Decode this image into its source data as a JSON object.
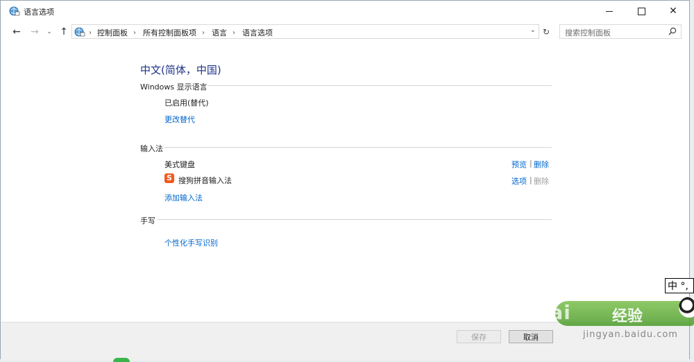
{
  "window": {
    "title": "语言选项",
    "controls": {
      "minimize": "—",
      "maximize": "□",
      "close": "✕"
    }
  },
  "nav": {
    "back": "←",
    "forward": "→",
    "recent": "⌄",
    "up": "↑",
    "breadcrumbs": [
      "控制面板",
      "所有控制面板项",
      "语言",
      "语言选项"
    ],
    "separator": "›",
    "dropdown": "⌄",
    "refresh": "↻",
    "search_placeholder": "搜索控制面板"
  },
  "content": {
    "heading": "中文(简体，中国)",
    "display_language": {
      "label": "Windows 显示语言",
      "status": "已启用(替代)",
      "change_link": "更改替代"
    },
    "input_methods": {
      "label": "输入法",
      "items": [
        {
          "name": "美式键盘",
          "action1": "预览",
          "action2": "删除",
          "action2_enabled": true
        },
        {
          "name": "搜狗拼音输入法",
          "icon": "sogou-icon",
          "action1": "选项",
          "action2": "删除",
          "action2_enabled": false
        }
      ],
      "pipe": "|",
      "add_link": "添加输入法"
    },
    "handwriting": {
      "label": "手写",
      "personalize_link": "个性化手写识别"
    }
  },
  "footer": {
    "save": "保存",
    "cancel": "取消"
  },
  "overlay": {
    "ime_indicator": "中 °,",
    "watermark_brand": "Bai",
    "watermark_cn": "经验",
    "watermark_url": "jingyan.baidu.com"
  }
}
